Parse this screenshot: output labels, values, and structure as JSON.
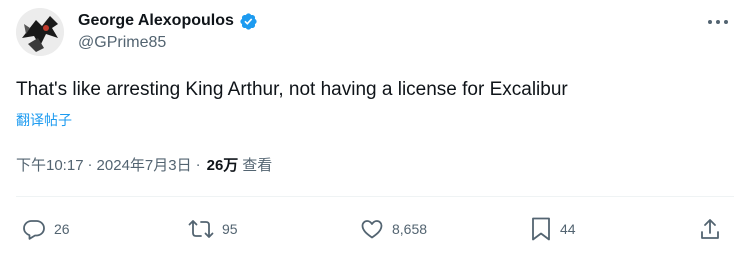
{
  "author": {
    "display_name": "George Alexopoulos",
    "handle": "@GPrime85",
    "verified": true
  },
  "tweet": {
    "text": "That's like arresting King Arthur, not having a license for Excalibur",
    "translate_label": "翻译帖子"
  },
  "meta": {
    "time": "下午10:17",
    "separator": "·",
    "date": "2024年7月3日",
    "views_count": "26万",
    "views_label": "查看"
  },
  "actions": {
    "replies": "26",
    "retweets": "95",
    "likes": "8,658",
    "bookmarks": "44"
  },
  "colors": {
    "accent": "#1d9bf0",
    "secondary_text": "#536471",
    "primary_text": "#0f1419"
  },
  "icons": [
    "more-icon",
    "verified-badge-icon",
    "reply-icon",
    "retweet-icon",
    "like-icon",
    "bookmark-icon",
    "share-icon"
  ]
}
